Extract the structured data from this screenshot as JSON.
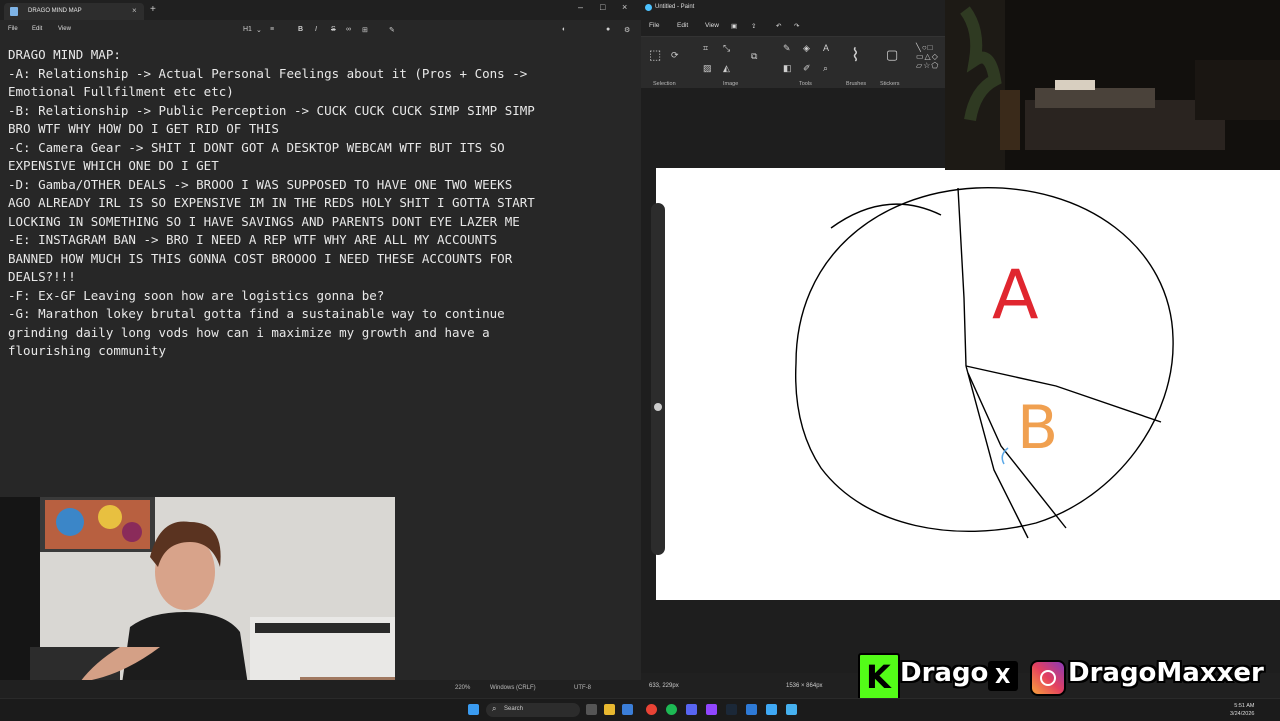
{
  "notepad": {
    "tab_title": "DRAGO MIND MAP",
    "menu": [
      "File",
      "Edit",
      "View"
    ],
    "heading_style": "H1",
    "lines": [
      "DRAGO MIND MAP:",
      "-A: Relationship -> Actual Personal Feelings about it (Pros + Cons ->",
      "Emotional Fullfilment etc etc)",
      "-B: Relationship -> Public Perception -> CUCK CUCK CUCK SIMP SIMP SIMP",
      "BRO WTF WHY HOW DO I GET RID OF THIS",
      "-C: Camera Gear -> SHIT I DONT GOT A DESKTOP WEBCAM WTF BUT ITS SO",
      "EXPENSIVE WHICH ONE DO I GET",
      "-D: Gamba/OTHER DEALS -> BROOO I WAS SUPPOSED TO HAVE ONE TWO WEEKS",
      "AGO ALREADY IRL IS SO EXPENSIVE IM IN THE REDS HOLY SHIT I GOTTA START",
      "LOCKING IN SOMETHING SO I HAVE SAVINGS AND PARENTS DONT EYE LAZER ME",
      "-E: INSTAGRAM BAN -> BRO I NEED A REP WTF WHY ARE ALL MY ACCOUNTS",
      "BANNED HOW MUCH IS THIS GONNA COST BROOOO I NEED THESE ACCOUNTS FOR",
      "DEALS?!!!",
      "-F: Ex-GF Leaving soon how are logistics gonna be?",
      "-G: Marathon lokey brutal gotta find a sustainable way to continue",
      "grinding daily long vods how can i maximize my growth and have a",
      "flourishing community"
    ],
    "status": {
      "zoom": "220%",
      "line_ending": "Windows (CRLF)",
      "encoding": "UTF-8"
    }
  },
  "paint": {
    "title": "Untitled - Paint",
    "menu": [
      "File",
      "Edit",
      "View"
    ],
    "groups": [
      "Selection",
      "Image",
      "Tools",
      "Brushes",
      "Stickers"
    ],
    "status": {
      "cursor": "633, 229px",
      "size": "1536 × 864px"
    },
    "labels": {
      "a": "A",
      "b": "B"
    },
    "colors": {
      "a": "#e0262f",
      "b": "#f0a050",
      "c": "#5aa8e8"
    }
  },
  "overlay": {
    "kick_letter": "K",
    "kick_name": "Drago",
    "x_letter": "X",
    "ig_name": "DragoMaxxer",
    "kick_color": "#53fc18"
  },
  "taskbar": {
    "search": "Search",
    "time": "5:51 AM",
    "date": "3/24/2026"
  }
}
